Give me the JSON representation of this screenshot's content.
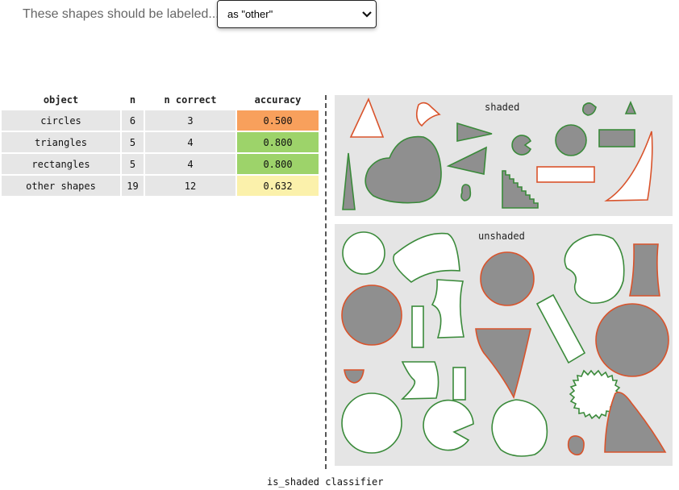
{
  "prompt": {
    "label": "These shapes should be labeled..."
  },
  "select": {
    "value": "as \"other\""
  },
  "table": {
    "headers": [
      "object",
      "n",
      "n correct",
      "accuracy"
    ],
    "rows": [
      {
        "object": "circles",
        "n": "6",
        "correct": "3",
        "accuracy": "0.500",
        "color": "#f8a05c"
      },
      {
        "object": "triangles",
        "n": "5",
        "correct": "4",
        "accuracy": "0.800",
        "color": "#9dd36a"
      },
      {
        "object": "rectangles",
        "n": "5",
        "correct": "4",
        "accuracy": "0.800",
        "color": "#9dd36a"
      },
      {
        "object": "other shapes",
        "n": "19",
        "correct": "12",
        "accuracy": "0.632",
        "color": "#fbf1ab"
      }
    ]
  },
  "panels": {
    "shaded_title": "shaded",
    "unshaded_title": "unshaded"
  },
  "caption": "is_shaded classifier",
  "colors": {
    "correct_outline": "#3a8a3a",
    "incorrect_outline": "#d9532b",
    "fill_gray": "#8f8f8f",
    "panel_bg": "#e5e5e5"
  }
}
